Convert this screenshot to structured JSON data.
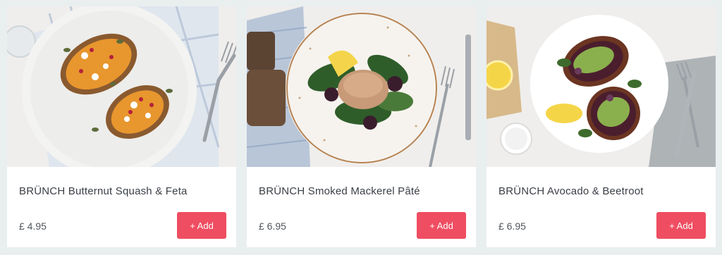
{
  "products": [
    {
      "title": "BRÜNCH Butternut Squash & Feta",
      "price": "£ 4.95",
      "add_label": "+ Add",
      "photo_icon": "butternut-squash-toast-photo"
    },
    {
      "title": "BRÜNCH Smoked Mackerel Pâté",
      "price": "£ 6.95",
      "add_label": "+ Add",
      "photo_icon": "mackerel-pate-salad-photo"
    },
    {
      "title": "BRÜNCH Avocado & Beetroot",
      "price": "£ 6.95",
      "add_label": "+ Add",
      "photo_icon": "avocado-beetroot-toast-photo"
    }
  ],
  "colors": {
    "accent": "#ef4d61",
    "background": "#e9eeef",
    "card": "#ffffff",
    "text": "#3b3f45"
  }
}
